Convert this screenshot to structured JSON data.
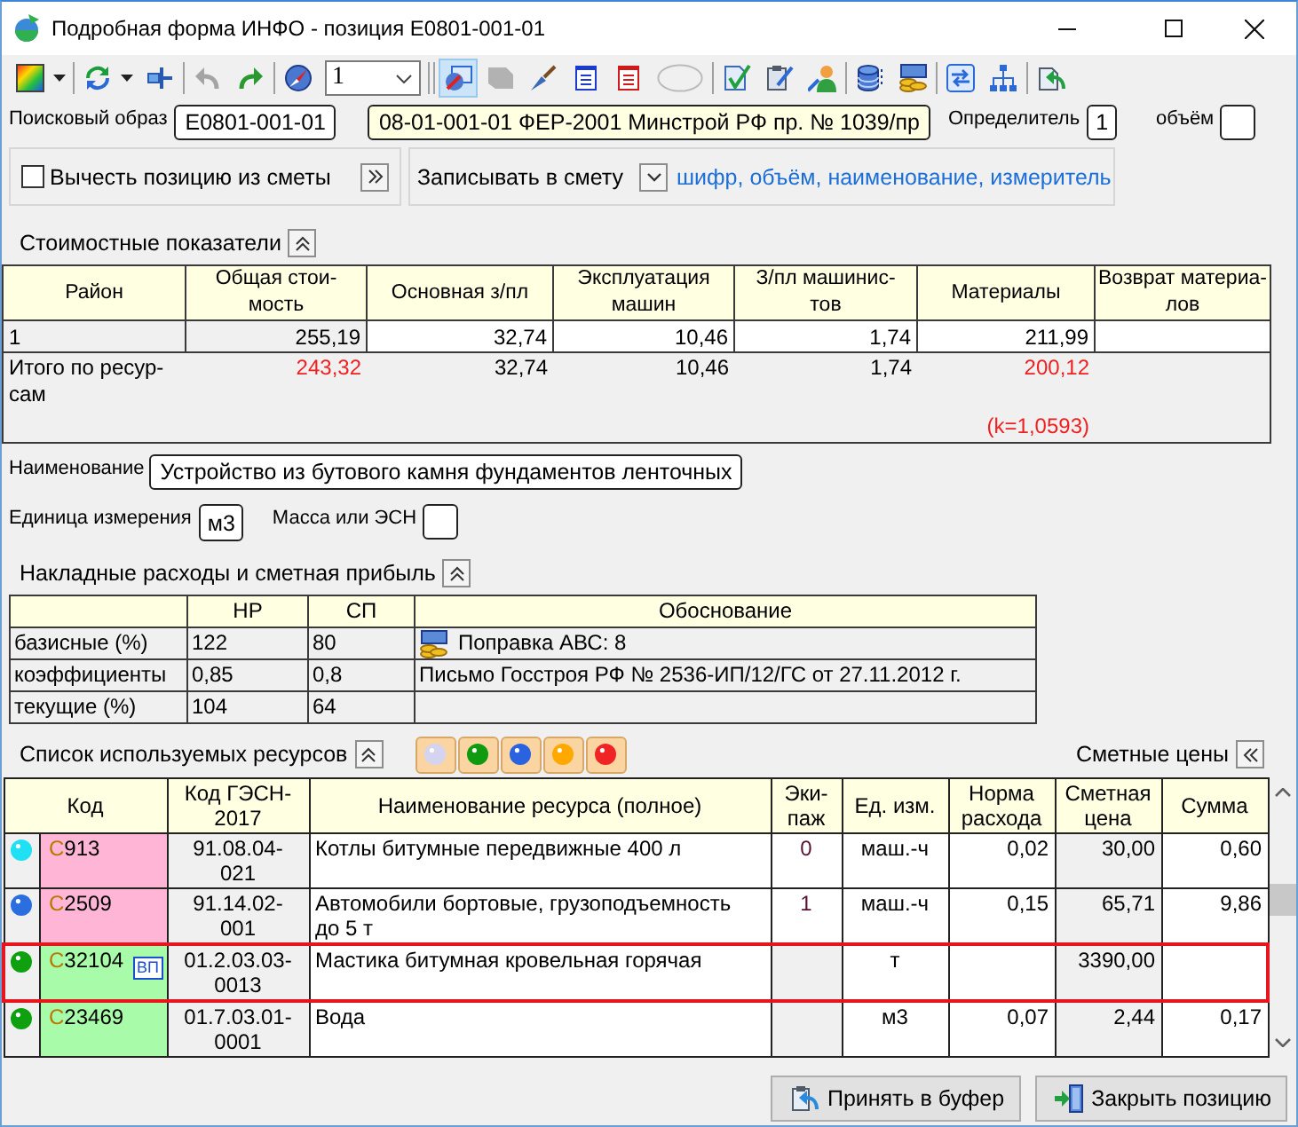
{
  "window": {
    "title": "Подробная форма ИНФО - позиция E0801-001-01"
  },
  "toolbar": {
    "items": [
      {
        "kind": "split_button",
        "pressed": false,
        "disabled": false
      },
      {
        "kind": "separator"
      },
      {
        "kind": "split_button",
        "pressed": false,
        "disabled": false
      },
      {
        "kind": "button",
        "pressed": false,
        "disabled": false
      },
      {
        "kind": "separator"
      },
      {
        "kind": "button",
        "pressed": false,
        "disabled": true
      },
      {
        "kind": "button",
        "pressed": false,
        "disabled": false
      },
      {
        "kind": "separator"
      },
      {
        "kind": "button",
        "pressed": false,
        "disabled": false
      },
      {
        "kind": "combo",
        "value": "1"
      },
      {
        "kind": "separator"
      },
      {
        "kind": "separator"
      },
      {
        "kind": "button",
        "pressed": true,
        "disabled": false
      },
      {
        "kind": "button",
        "pressed": false,
        "disabled": true
      },
      {
        "kind": "button",
        "pressed": false,
        "disabled": false
      },
      {
        "kind": "button",
        "pressed": false,
        "disabled": false
      },
      {
        "kind": "button",
        "pressed": false,
        "disabled": false
      },
      {
        "kind": "button",
        "pressed": false,
        "disabled": true
      },
      {
        "kind": "separator"
      },
      {
        "kind": "button",
        "pressed": false,
        "disabled": false
      },
      {
        "kind": "button",
        "pressed": false,
        "disabled": false
      },
      {
        "kind": "button",
        "pressed": false,
        "disabled": false
      },
      {
        "kind": "separator"
      },
      {
        "kind": "button",
        "pressed": false,
        "disabled": false
      },
      {
        "kind": "button",
        "pressed": false,
        "disabled": false
      },
      {
        "kind": "separator"
      },
      {
        "kind": "button",
        "pressed": false,
        "disabled": false
      },
      {
        "kind": "button",
        "pressed": false,
        "disabled": false
      },
      {
        "kind": "separator"
      },
      {
        "kind": "button",
        "pressed": false,
        "disabled": false
      }
    ]
  },
  "search": {
    "label": "Поисковый образ",
    "value": "E0801-001-01",
    "reference": "08-01-001-01 ФЕР-2001 Минстрой РФ пр. № 1039/пр",
    "determinant": {
      "label": "Определитель",
      "value": "1"
    },
    "volume": {
      "label": "объём"
    }
  },
  "subtract": {
    "label": "Вычесть позицию из сметы",
    "checked": false
  },
  "write_to_estimate": {
    "label": "Записывать в смету",
    "value": "шифр, объём, наименование, измеритель"
  },
  "cost_indicators": {
    "title": "Стоимостные показатели",
    "expanded": true,
    "columns": [
      "Район",
      "Общая стои-\nмость",
      "Основная з/пл",
      "Эксплуатация\nмашин",
      "З/пл машинис-\nтов",
      "Материалы",
      "Возврат материа-\nлов"
    ],
    "rows": [
      {
        "kind": "region",
        "cells": [
          {
            "text": "1",
            "mismatch": false
          },
          {
            "text": "255,19",
            "mismatch": false
          },
          {
            "text": "32,74",
            "mismatch": false
          },
          {
            "text": "10,46",
            "mismatch": false
          },
          {
            "text": "1,74",
            "mismatch": false
          },
          {
            "text": "211,99",
            "mismatch": false
          }
        ]
      },
      {
        "kind": "total",
        "cells": [
          {
            "text": "Итого по ресур-\nсам",
            "mismatch": false
          },
          {
            "text": "243,32",
            "mismatch": true
          },
          {
            "text": "32,74",
            "mismatch": false
          },
          {
            "text": "10,46",
            "mismatch": false
          },
          {
            "text": "1,74",
            "mismatch": false
          },
          {
            "text": "200,12",
            "mismatch": true,
            "note": "(k=1,0593)"
          }
        ]
      }
    ]
  },
  "name": {
    "label": "Наименование",
    "value": "Устройство из бутового камня фундаментов ленточных"
  },
  "unit": {
    "label": "Единица измерения",
    "value": "м3"
  },
  "mass": {
    "label": "Масса или ЭСН"
  },
  "overheads": {
    "title": "Накладные расходы и сметная прибыль",
    "expanded": true,
    "columns": [
      "НР",
      "СП",
      "Обоснование"
    ],
    "rows": [
      {
        "label": "базисные (%)",
        "nr": "122",
        "sp": "80",
        "basis": "Поправка АВС: 8",
        "basis_icon": true
      },
      {
        "label": "коэффициенты",
        "nr": "0,85",
        "sp": "0,8",
        "basis": "Письмо Госстроя РФ № 2536-ИП/12/ГС от 27.11.2012 г.",
        "basis_icon": false
      },
      {
        "label": "текущие (%)",
        "nr": "104",
        "sp": "64",
        "basis_icon": false
      }
    ]
  },
  "resources": {
    "title": "Список используемых ресурсов",
    "expanded": true,
    "filters": [
      {
        "color": "#d4d4f0"
      },
      {
        "color": "#109a10"
      },
      {
        "color": "#2a62e0"
      },
      {
        "color": "#ffa800"
      },
      {
        "color": "#f02424"
      }
    ],
    "prices_label": "Сметные цены",
    "columns": [
      "Код",
      "Код ГЭСН-\n2017",
      "Наименование ресурса (полное)",
      "Эки-\nпаж",
      "Ед. изм.",
      "Норма\nрасхода",
      "Сметная\nцена",
      "Сумма"
    ],
    "rows": [
      {
        "color": "#20e0f4",
        "kind": "machine",
        "code": "C913",
        "gesn": "91.08.04-\n021",
        "name": "Котлы битумные передвижные 400 л",
        "crew": "0",
        "unit": "маш.-ч",
        "norm": "0,02",
        "price": "30,00",
        "sum": "0,60",
        "selected": false
      },
      {
        "color": "#2a6ee0",
        "kind": "machine",
        "code": "C2509",
        "gesn": "91.14.02-\n001",
        "name": "Автомобили бортовые, грузоподъемность до 5 т",
        "crew": "1",
        "unit": "маш.-ч",
        "norm": "0,15",
        "price": "65,71",
        "sum": "9,86",
        "selected": false
      },
      {
        "color": "#0fa00f",
        "kind": "material",
        "code": "C32104",
        "flag": "ВП",
        "gesn": "01.2.03.03-\n0013",
        "name": "Мастика битумная кровельная горячая",
        "unit": "т",
        "price": "3390,00",
        "selected": true
      },
      {
        "color": "#0fa00f",
        "kind": "material",
        "code": "C23469",
        "gesn": "01.7.03.01-\n0001",
        "name": "Вода",
        "unit": "м3",
        "norm": "0,07",
        "price": "2,44",
        "sum": "0,17",
        "selected": false
      }
    ]
  },
  "buttons": [
    {
      "label": "Принять в буфер"
    },
    {
      "label": "Закрыть позицию"
    }
  ]
}
